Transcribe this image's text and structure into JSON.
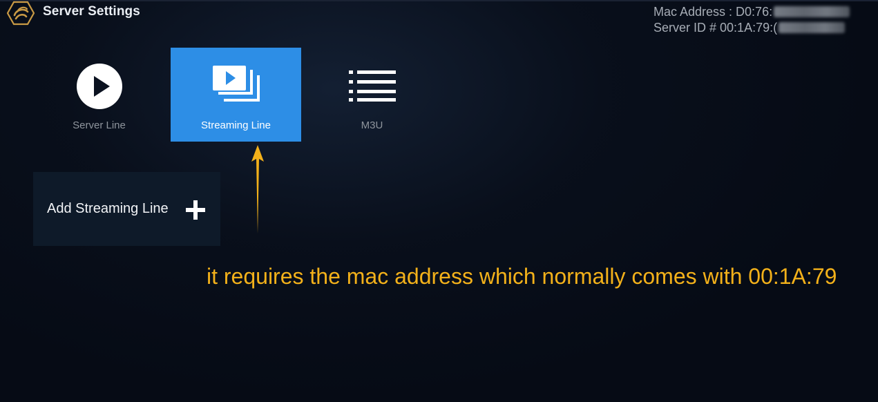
{
  "header": {
    "title": "Server Settings",
    "logo_icon": "logo-icon",
    "mac_address_label": "Mac Address : D0:76:",
    "server_id_label": "Server ID # 00:1A:79:("
  },
  "tabs": [
    {
      "label": "Server Line",
      "icon": "play-circle-icon",
      "selected": false
    },
    {
      "label": "Streaming Line",
      "icon": "playlist-play-icon",
      "selected": true
    },
    {
      "label": "M3U",
      "icon": "list-icon",
      "selected": false
    }
  ],
  "add_line": {
    "label": "Add Streaming Line",
    "icon": "plus-icon"
  },
  "annotation": {
    "text": "it requires the mac address which normally comes with 00:1A:79",
    "color": "#f3b11a"
  },
  "colors": {
    "accent": "#2d8ee6",
    "background": "#060b15",
    "panel": "#0e1a29"
  }
}
